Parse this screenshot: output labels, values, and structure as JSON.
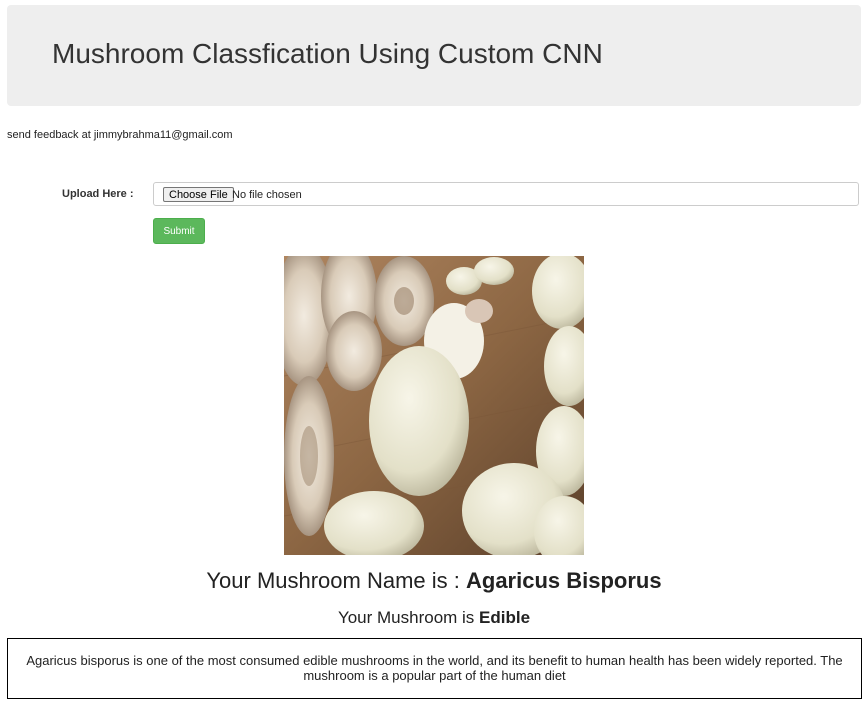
{
  "header": {
    "title": "Mushroom Classfication Using Custom CNN"
  },
  "feedback": {
    "text": "send feedback at jimmybrahma11@gmail.com"
  },
  "upload": {
    "label": "Upload Here :",
    "choose_button": "Choose File",
    "status": "No file chosen",
    "submit_label": "Submit",
    "accent_color": "#5cb85c"
  },
  "result": {
    "name_prefix": "Your Mushroom Name is : ",
    "name_value": "Agaricus Bisporus",
    "edible_prefix": "Your Mushroom is ",
    "edible_value": "Edible",
    "description": "Agaricus bisporus is one of the most consumed edible mushrooms in the world, and its benefit to human health has been widely reported. The mushroom is a popular part of the human diet"
  }
}
